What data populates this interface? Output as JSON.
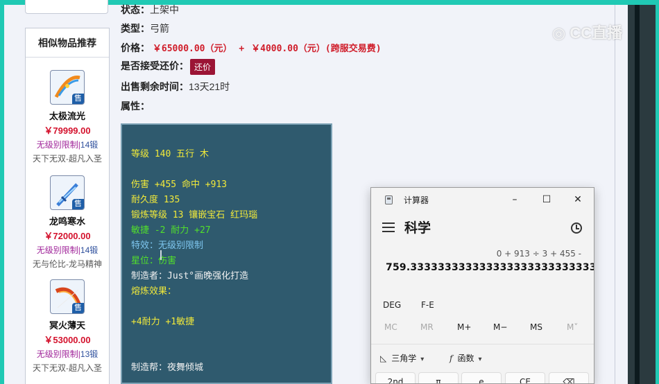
{
  "status": {
    "label": "状态：",
    "value": "上架中"
  },
  "type": {
    "label": "类型：",
    "value": "弓箭"
  },
  "price": {
    "label": "价格：",
    "main": "￥65000.00（元）",
    "plus": "+",
    "fee": "￥4000.00（元）(跨服交易费)"
  },
  "bargain": {
    "label": "是否接受还价：",
    "button": "还价"
  },
  "time_left": {
    "label": "出售剩余时间：",
    "value": "13天21时"
  },
  "attributes_label": "属性：",
  "attributes": {
    "level": "等级 140 五行 木",
    "damage": "伤害 +455 命中 +913",
    "durability": "耐久度 135",
    "forge": "锻炼等级 13 镶嵌宝石 红玛瑙",
    "agility": "敏捷 -2 耐力 +27",
    "effect": "特效：无级别限制",
    "star": "星位：伤害",
    "maker": "制造者：Just°画晚强化打造",
    "melt": "熔炼效果：",
    "melt_effect": "+4耐力 +1敏捷",
    "guild": "制造帮：夜舞倾城"
  },
  "recommend": {
    "title": "相似物品推荐",
    "items": [
      {
        "name": "太极流光",
        "price": "￥79999.00",
        "limit": "无级别限制",
        "lock": "14锻",
        "desc": "天下无双-超凡入圣",
        "badge": "售"
      },
      {
        "name": "龙鸣寒水",
        "price": "￥72000.00",
        "limit": "无级别限制",
        "lock": "14锻",
        "desc": "无与伦比-龙马精神",
        "badge": "售"
      },
      {
        "name": "冥火薄天",
        "price": "￥53000.00",
        "limit": "无级别限制",
        "lock": "13锻",
        "desc": "天下无双-超凡入圣",
        "badge": "售"
      }
    ]
  },
  "watermark": "CC直播",
  "calculator": {
    "title": "计算器",
    "mode": "科学",
    "expression": "0 + 913 ÷ 3 + 455 -",
    "result": "759.3333333333333333333333333333",
    "options": [
      "DEG",
      "F-E"
    ],
    "memory": [
      "MC",
      "MR",
      "M+",
      "M−",
      "MS",
      "M˅"
    ],
    "functions": {
      "trig": "三角学",
      "func": "函数"
    },
    "keys": [
      "2nd",
      "π",
      "e",
      "CE",
      "⌫"
    ],
    "window_buttons": {
      "minimize": "–",
      "maximize": "☐",
      "close": "✕"
    }
  }
}
